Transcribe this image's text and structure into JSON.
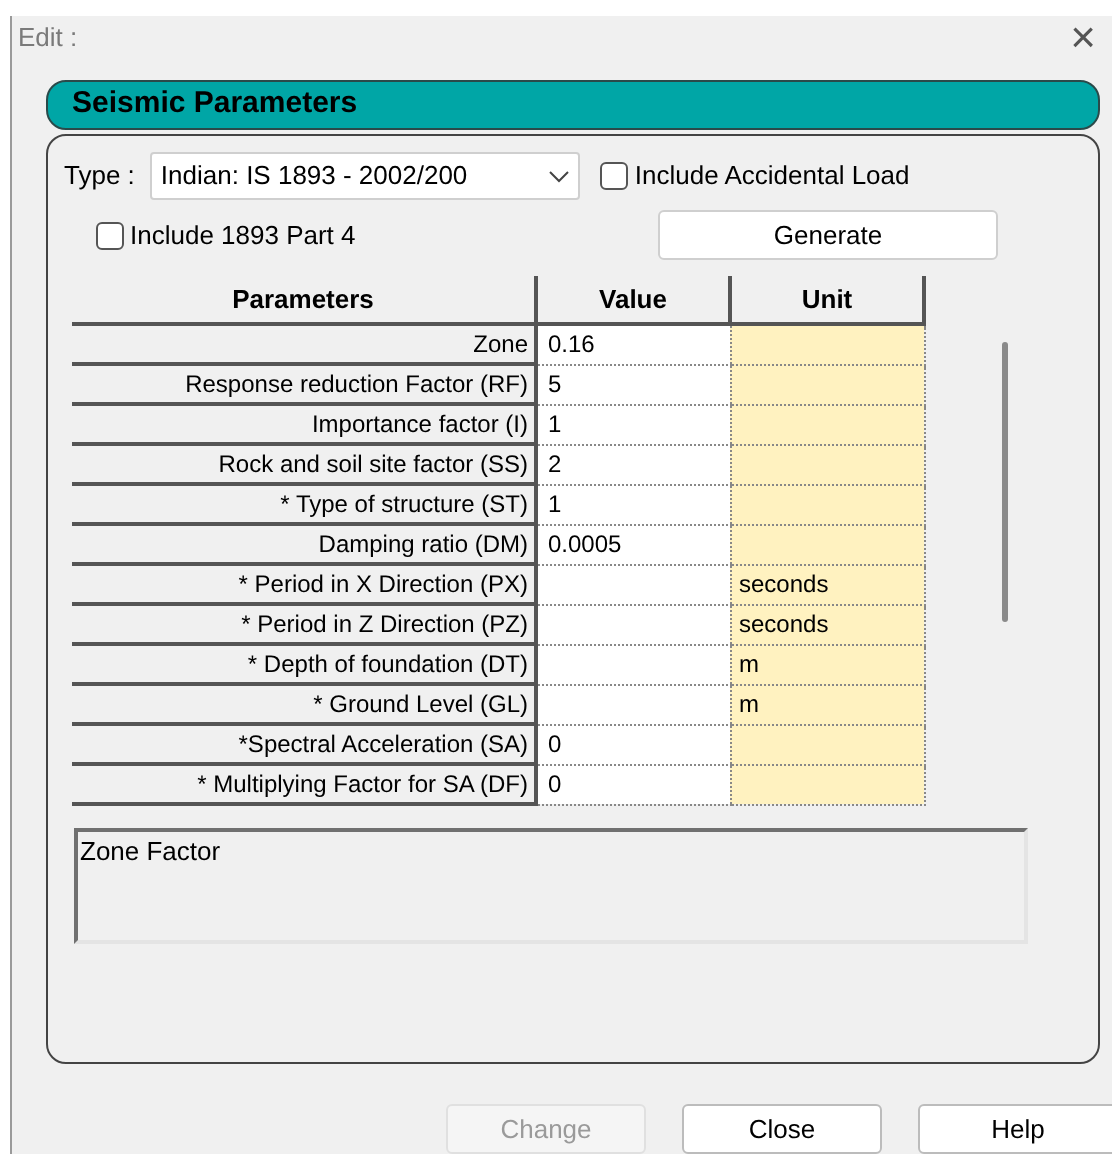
{
  "window": {
    "title": "Edit :",
    "close": "×"
  },
  "section_title": "Seismic Parameters",
  "type_label": "Type :",
  "type_select": {
    "value": "Indian: IS 1893 - 2002/200"
  },
  "checkboxes": [
    {
      "label": "Include Accidental Load",
      "checked": false
    },
    {
      "label": "Include 1893 Part 4",
      "checked": false
    }
  ],
  "generate_button": "Generate",
  "table": {
    "columns": [
      "Parameters",
      "Value",
      "Unit"
    ],
    "rows": [
      {
        "parameter": "Zone",
        "value": "0.16",
        "unit": ""
      },
      {
        "parameter": "Response reduction Factor (RF)",
        "value": "5",
        "unit": ""
      },
      {
        "parameter": "Importance factor (I)",
        "value": "1",
        "unit": ""
      },
      {
        "parameter": "Rock and soil site factor (SS)",
        "value": "2",
        "unit": ""
      },
      {
        "parameter": "* Type of structure (ST)",
        "value": "1",
        "unit": ""
      },
      {
        "parameter": "Damping ratio (DM)",
        "value": "0.0005",
        "unit": ""
      },
      {
        "parameter": "* Period in X Direction (PX)",
        "value": "",
        "unit": "seconds"
      },
      {
        "parameter": "* Period in Z Direction (PZ)",
        "value": "",
        "unit": "seconds"
      },
      {
        "parameter": "* Depth of foundation (DT)",
        "value": "",
        "unit": "m"
      },
      {
        "parameter": "* Ground Level (GL)",
        "value": "",
        "unit": "m"
      },
      {
        "parameter": "*Spectral Acceleration (SA)",
        "value": "0",
        "unit": ""
      },
      {
        "parameter": "* Multiplying Factor for SA (DF)",
        "value": "0",
        "unit": ""
      }
    ]
  },
  "description": "Zone Factor",
  "buttons": [
    {
      "label": "Change",
      "disabled": true
    },
    {
      "label": "Close",
      "disabled": false
    },
    {
      "label": "Help",
      "disabled": false
    }
  ]
}
